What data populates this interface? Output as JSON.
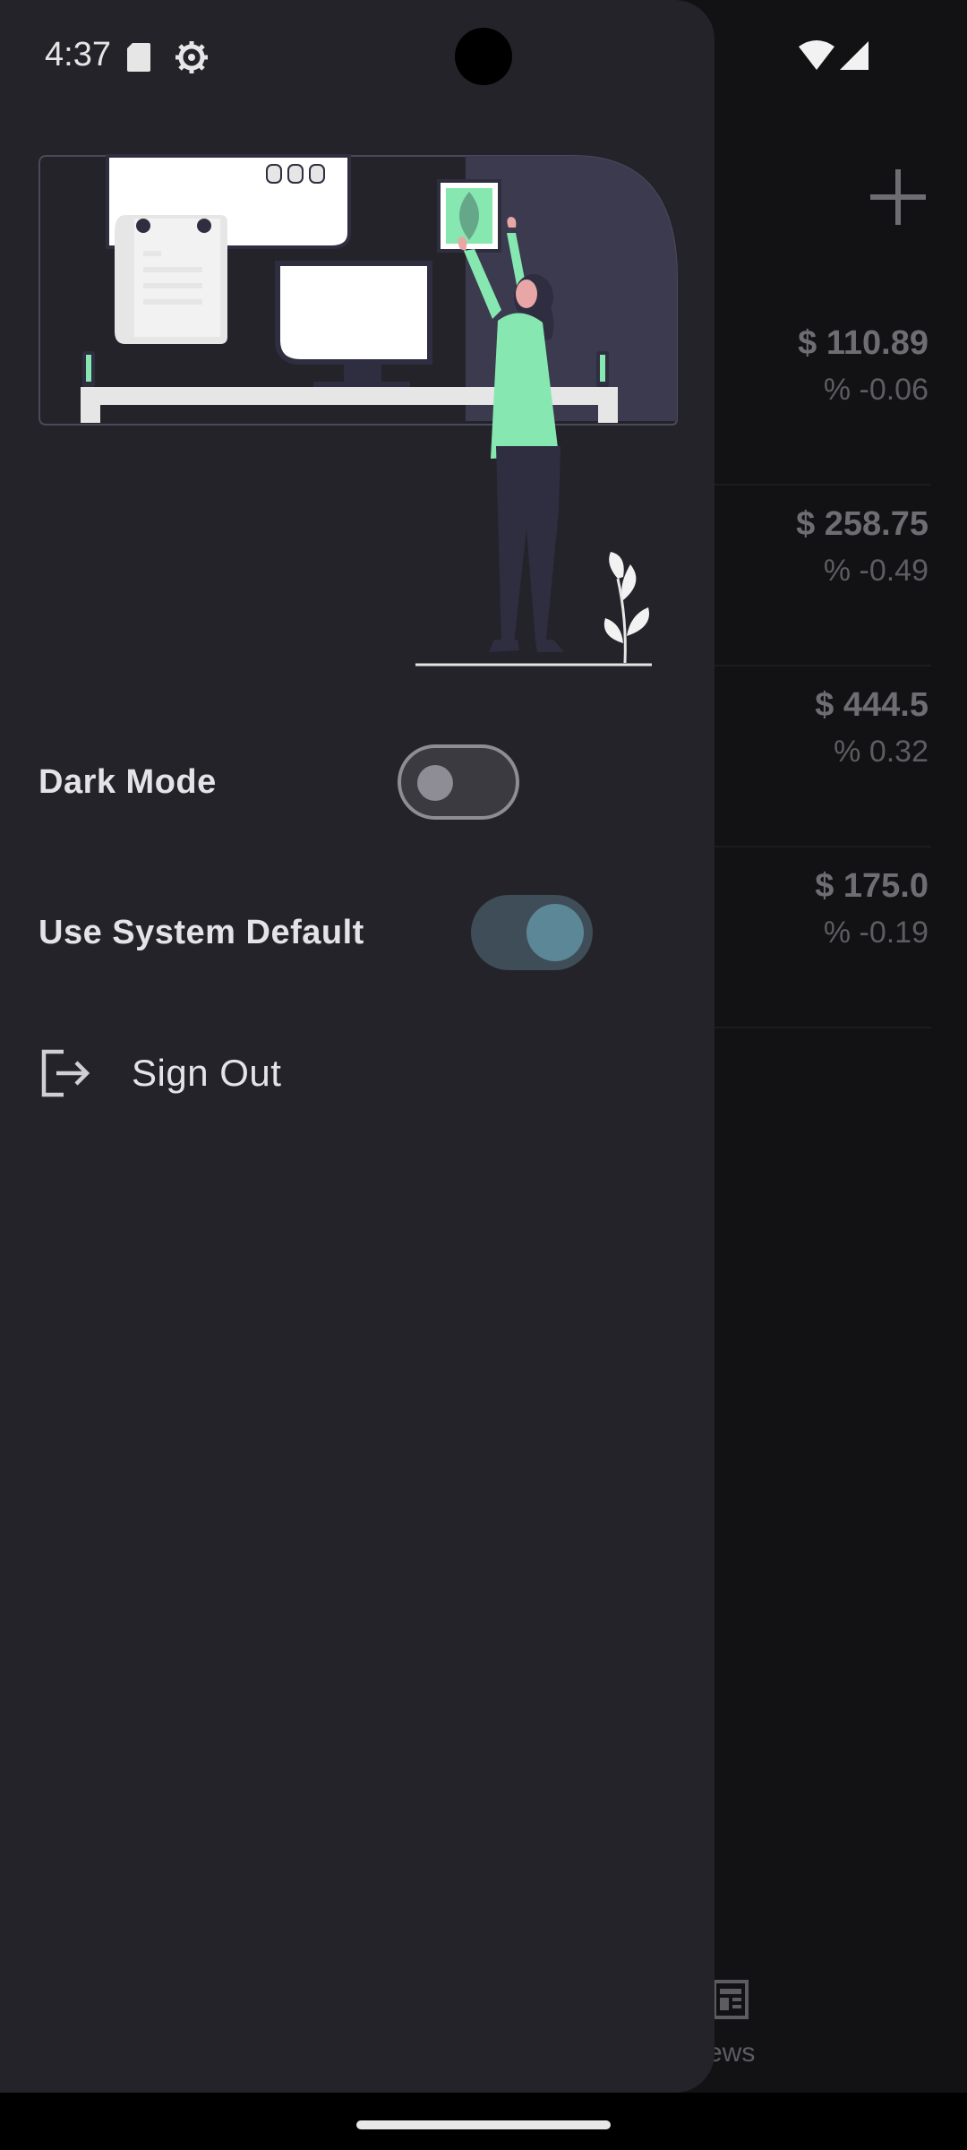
{
  "status_bar": {
    "time": "4:37",
    "icons": [
      "sd-card-icon",
      "settings-gear-icon",
      "wifi-icon",
      "cellular-signal-icon"
    ]
  },
  "background_app": {
    "add_icon": "plus-icon",
    "rows": [
      {
        "price": "$ 110.89",
        "change": "% -0.06"
      },
      {
        "price": "$ 258.75",
        "change": "% -0.49"
      },
      {
        "price": "$ 444.5",
        "change": "% 0.32"
      },
      {
        "price": "$ 175.0",
        "change": "% -0.19"
      }
    ],
    "bottom_nav": {
      "news_label": "ews",
      "news_icon": "newspaper-icon"
    }
  },
  "drawer": {
    "illustration": "woman-hanging-plant-picture-illustration",
    "settings": {
      "dark_mode": {
        "label": "Dark Mode",
        "checked": false
      },
      "use_system_default": {
        "label": "Use System Default",
        "checked": true
      }
    },
    "sign_out": {
      "label": "Sign Out",
      "icon": "logout-icon"
    }
  },
  "colors": {
    "drawer_bg": "#232329",
    "accent_green": "#86e8b0",
    "switch_on_track": "#3e4d57",
    "switch_on_thumb": "#5c8796",
    "switch_off_outline": "#8e8c95"
  }
}
